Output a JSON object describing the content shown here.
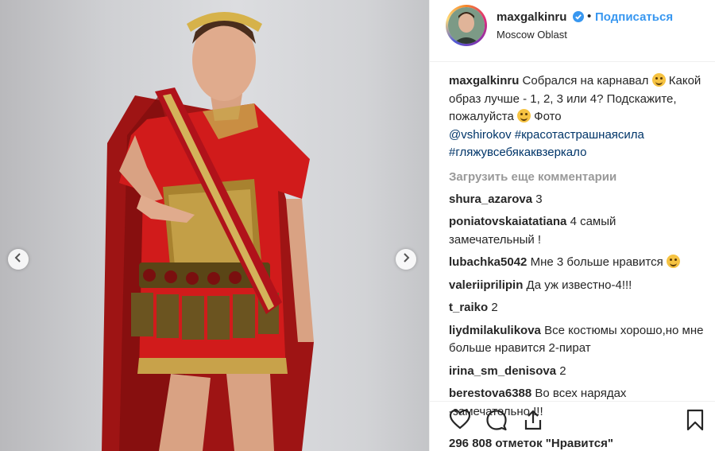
{
  "post": {
    "username": "maxgalkinru",
    "follow_label": "Подписаться",
    "separator": "•",
    "location": "Moscow Oblast",
    "caption": {
      "username": "maxgalkinru",
      "text_1": "Собрался на карнавал ",
      "text_2": " Какой образ лучше - 1, 2, 3 или 4? Подскажите, пожалуйста ",
      "text_3": " Фото ",
      "mention": "@vshirokov",
      "hashtag_1": "#красотастрашнаясила",
      "hashtag_2": "#гляжувсебякаквзеркало"
    },
    "load_more_label": "Загрузить еще комментарии",
    "likes_text": "296 808 отметок \"Нравится\""
  },
  "comments": [
    {
      "user": "shura_azarova",
      "text": "3"
    },
    {
      "user": "poniatovskaiatatiana",
      "text": "4 самый замечательный !"
    },
    {
      "user": "lubachka5042",
      "text": "Мне 3 больше нравится"
    },
    {
      "user": "valeriiprilipin",
      "text": "Да уж известно-4!!!"
    },
    {
      "user": "t_raiko",
      "text": "2"
    },
    {
      "user": "liydmilakulikova",
      "text": "Все костюмы хорошо,но мне больше нравится 2-пират"
    },
    {
      "user": "irina_sm_denisova",
      "text": "2"
    },
    {
      "user": "berestova6388",
      "text": "Во всех нарядах -замечательно !!!"
    }
  ],
  "icons": {
    "like": "heart-icon",
    "comment": "comment-icon",
    "share": "share-icon",
    "save": "bookmark-icon",
    "verified": "verified-badge-icon",
    "prev": "chevron-left-icon",
    "next": "chevron-right-icon"
  },
  "colors": {
    "link": "#003569",
    "follow": "#3897f0",
    "muted": "#999999",
    "verified": "#3897f0"
  }
}
